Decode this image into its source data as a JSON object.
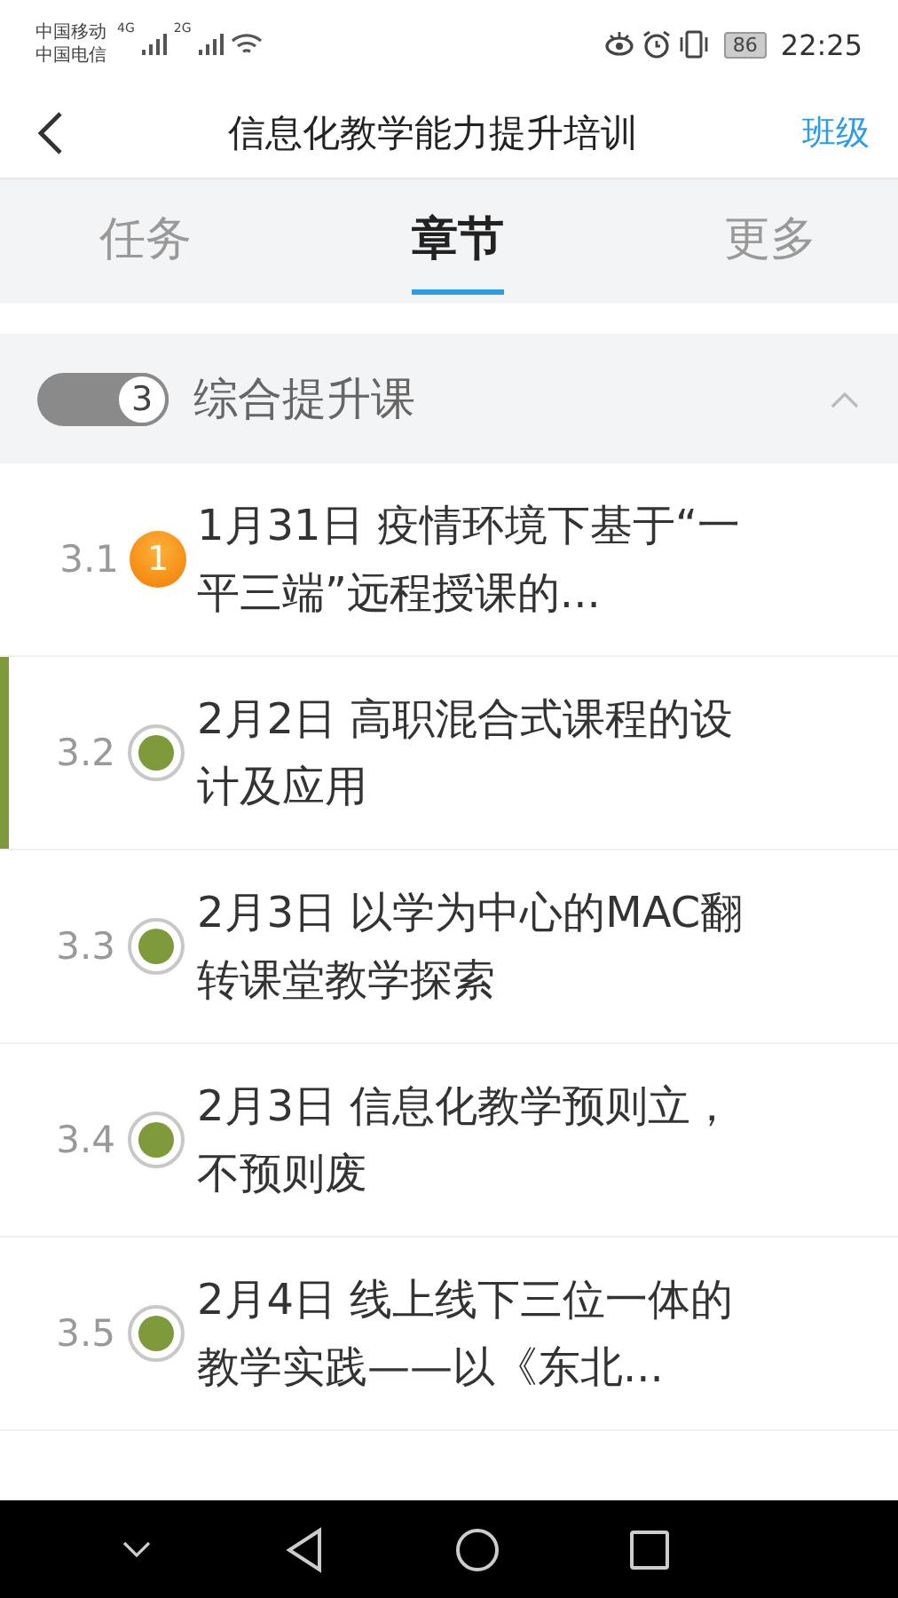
{
  "status_bar": {
    "carrier_1": "中国移动",
    "carrier_2": "中国电信",
    "network_1": "4G",
    "network_2": "2G",
    "battery": "86",
    "time": "22:25"
  },
  "header": {
    "title": "信息化教学能力提升培训",
    "action": "班级"
  },
  "tabs": [
    {
      "label": "任务",
      "selected": false
    },
    {
      "label": "章节",
      "selected": true
    },
    {
      "label": "更多",
      "selected": false
    }
  ],
  "section": {
    "number": "3",
    "title": "综合提升课",
    "expanded": true
  },
  "chapters": [
    {
      "number": "3.1",
      "title": "1月31日 疫情环境下基于“一平三端”远程授课的...",
      "status": {
        "kind": "badge",
        "count": "1"
      },
      "selected": false
    },
    {
      "number": "3.2",
      "title": "2月2日 高职混合式课程的设计及应用",
      "status": {
        "kind": "done"
      },
      "selected": true
    },
    {
      "number": "3.3",
      "title": "2月3日 以学为中心的MAC翻转课堂教学探索",
      "status": {
        "kind": "done"
      },
      "selected": false
    },
    {
      "number": "3.4",
      "title": "2月3日 信息化教学预则立，不预则废",
      "status": {
        "kind": "done"
      },
      "selected": false
    },
    {
      "number": "3.5",
      "title": "2月4日 线上线下三位一体的教学实践——以《东北...",
      "status": {
        "kind": "done"
      },
      "selected": false
    }
  ]
}
